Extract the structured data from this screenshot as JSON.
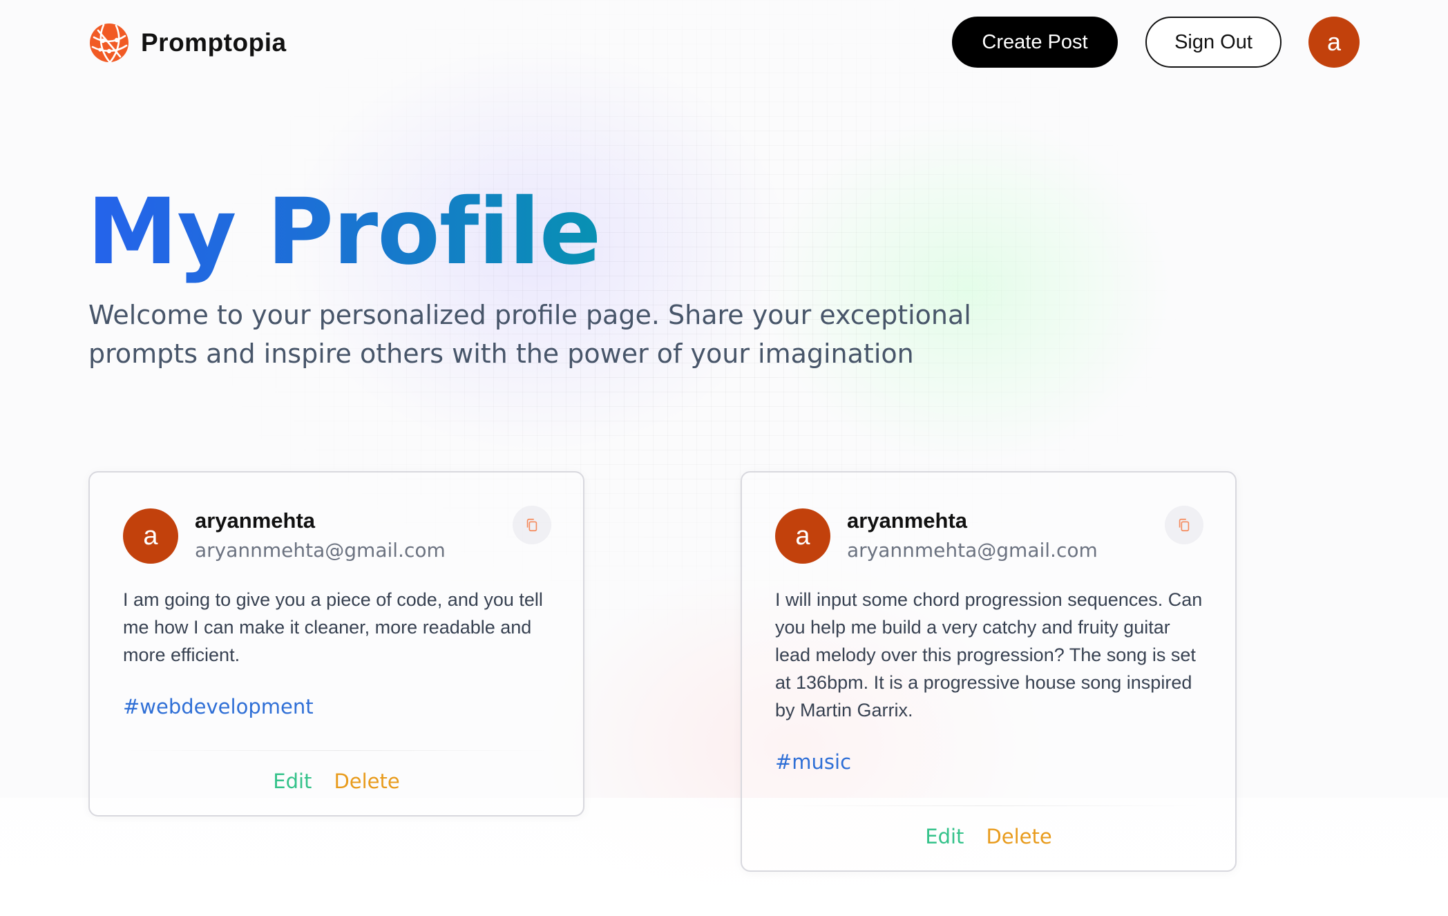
{
  "nav": {
    "brand": "Promptopia",
    "create_post": "Create Post",
    "sign_out": "Sign Out",
    "avatar_letter": "a"
  },
  "hero": {
    "title": "My Profile",
    "subtitle": "Welcome to your personalized profile page. Share your exceptional prompts and inspire others with the power of your imagination"
  },
  "posts": [
    {
      "avatar_letter": "a",
      "username": "aryanmehta",
      "email": "aryannmehta@gmail.com",
      "prompt": "I am going to give you a piece of code, and you tell me how I can make it cleaner, more readable and more efficient.",
      "tag": "#webdevelopment",
      "edit": "Edit",
      "delete": "Delete"
    },
    {
      "avatar_letter": "a",
      "username": "aryanmehta",
      "email": "aryannmehta@gmail.com",
      "prompt": "I will input some chord progression sequences. Can you help me build a very catchy and fruity guitar lead melody over this progression? The song is set at 136bpm. It is a progressive house song inspired by Martin Garrix.",
      "tag": "#music",
      "edit": "Edit",
      "delete": "Delete"
    }
  ],
  "colors": {
    "avatar": "#c2410c",
    "logo": "#f15a24",
    "tag": "#2f6fd6",
    "edit": "#34c28a",
    "delete": "#e89b1c",
    "title_start": "#2563eb",
    "title_end": "#0891b2"
  },
  "icons": {
    "logo": "globe-network-icon",
    "copy": "copy-icon"
  }
}
